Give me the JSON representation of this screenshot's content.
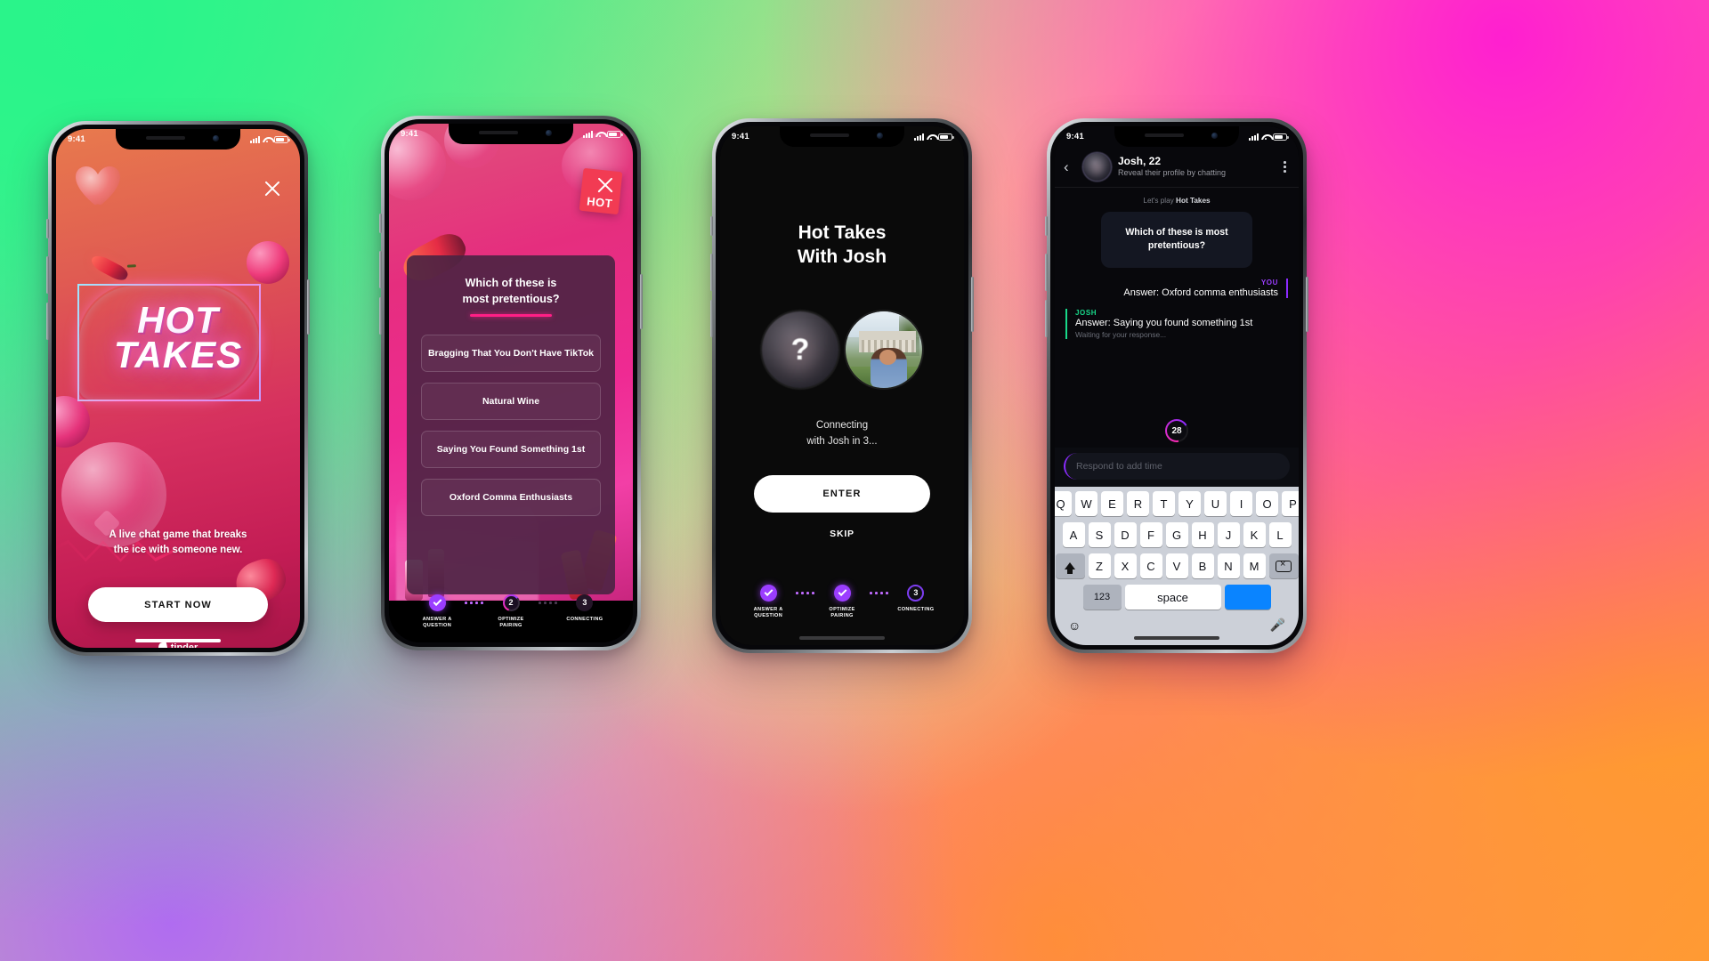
{
  "status_bar": {
    "time": "9:41"
  },
  "screen1": {
    "name": "hot-takes-splash",
    "close_icon": "close-icon",
    "logo_line1": "HOT",
    "logo_line2": "TAKES",
    "subtitle_line1": "A live chat game that breaks",
    "subtitle_line2": "the ice with someone new.",
    "cta_label": "START NOW",
    "brand": "tinder"
  },
  "screen2": {
    "name": "question-screen",
    "close_icon": "close-icon",
    "sticker_label": "HOT",
    "question": "Which of these is most pretentious?",
    "question_line1": "Which of these is",
    "question_line2": "most pretentious?",
    "options": [
      "Bragging That You Don't Have TikTok",
      "Natural Wine",
      "Saying You Found Something 1st",
      "Oxford Comma Enthusiasts"
    ],
    "steps": [
      {
        "marker": "check",
        "label_line1": "ANSWER A",
        "label_line2": "QUESTION",
        "state": "done"
      },
      {
        "marker": "2",
        "label_line1": "OPTIMIZE",
        "label_line2": "PAIRING",
        "state": "active"
      },
      {
        "marker": "3",
        "label_line1": "CONNECTING",
        "label_line2": "",
        "state": "idle"
      }
    ]
  },
  "screen3": {
    "name": "connecting-screen",
    "title_line1": "Hot Takes",
    "title_line2": "With Josh",
    "avatar_unknown_glyph": "?",
    "status_line1": "Connecting",
    "status_line2": "with Josh in 3...",
    "enter_label": "ENTER",
    "skip_label": "SKIP",
    "steps": [
      {
        "marker": "check",
        "label_line1": "ANSWER A",
        "label_line2": "QUESTION",
        "state": "done"
      },
      {
        "marker": "check",
        "label_line1": "OPTIMIZE",
        "label_line2": "PAIRING",
        "state": "done"
      },
      {
        "marker": "3",
        "label_line1": "CONNECTING",
        "label_line2": "",
        "state": "idle"
      }
    ]
  },
  "screen4": {
    "name": "chat-screen",
    "back_icon": "chevron-left-icon",
    "avatar": "blurred-avatar",
    "name_age": "Josh, 22",
    "subtitle": "Reveal their profile by chatting",
    "menu_icon": "more-vertical-icon",
    "system_prefix": "Let's play ",
    "system_game": "Hot Takes",
    "question_line1": "Which of these is most",
    "question_line2": "pretentious?",
    "message_you": {
      "label": "YOU",
      "text": "Answer: Oxford comma enthusiasts"
    },
    "message_josh": {
      "label": "JOSH",
      "text": "Answer: Saying you found something 1st",
      "hint": "Waiting for your response..."
    },
    "timer_value": "28",
    "input_placeholder": "Respond to add time",
    "keyboard": {
      "row1": [
        "Q",
        "W",
        "E",
        "R",
        "T",
        "Y",
        "U",
        "I",
        "O",
        "P"
      ],
      "row2": [
        "A",
        "S",
        "D",
        "F",
        "G",
        "H",
        "J",
        "K",
        "L"
      ],
      "row3": [
        "Z",
        "X",
        "C",
        "V",
        "B",
        "N",
        "M"
      ],
      "shift_icon": "shift-icon",
      "backspace_icon": "backspace-icon",
      "num_label": "123",
      "space_label": "space",
      "go_label": "",
      "emoji_icon": "emoji-icon",
      "mic_icon": "microphone-icon"
    }
  },
  "colors": {
    "accent_purple": "#8b2bff",
    "accent_pink": "#ff1f86",
    "accent_green": "#18d98a",
    "keyboard_blue": "#0a84ff"
  }
}
